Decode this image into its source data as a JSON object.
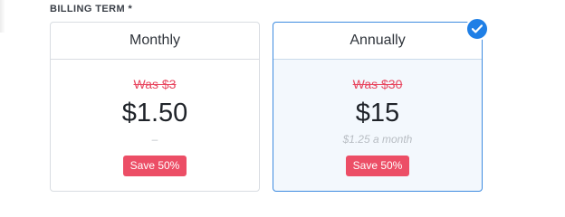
{
  "billing": {
    "label": "BILLING TERM *",
    "options": [
      {
        "title": "Monthly",
        "was": "Was $3",
        "price": "$1.50",
        "sub": "–",
        "badge": "Save 50%",
        "selected": false
      },
      {
        "title": "Annually",
        "was": "Was $30",
        "price": "$15",
        "sub": "$1.25 a month",
        "badge": "Save 50%",
        "selected": true
      }
    ]
  },
  "icons": {
    "selected": "checkmark-circle-icon"
  },
  "colors": {
    "accent": "#1f7fe6",
    "selected_border": "#3d8be0",
    "selected_bg": "#f3f8fd",
    "strike": "#e8465f",
    "badge_bg": "#ec4e66"
  }
}
